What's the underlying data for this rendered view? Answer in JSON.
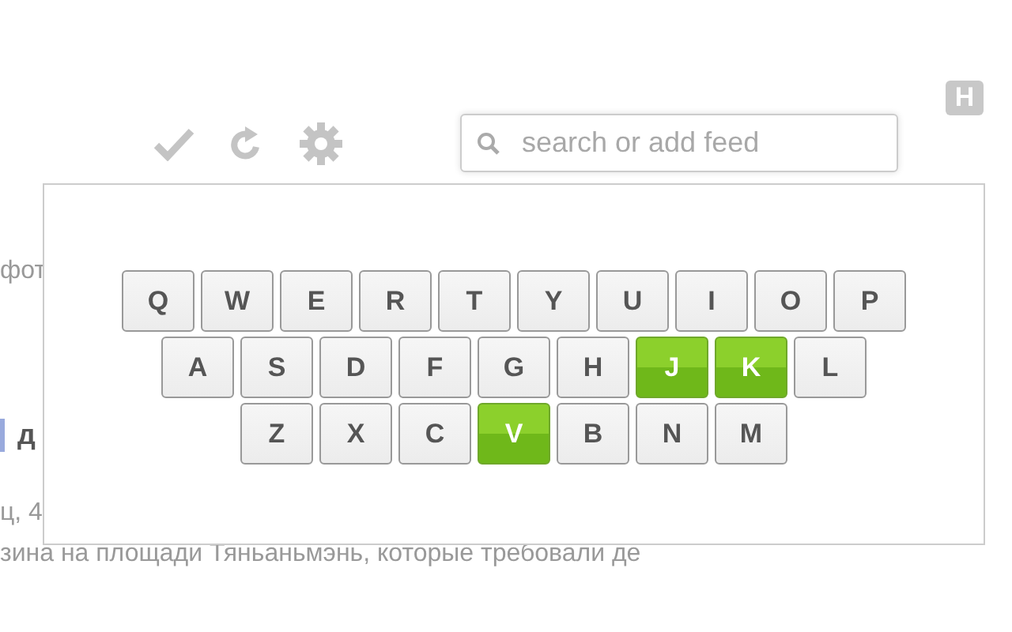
{
  "toolbar": {
    "search": {
      "placeholder": "search or add feed"
    },
    "badge": "H"
  },
  "background_text": [
    {
      "text": "фот",
      "bold": false
    },
    {
      "text": "д",
      "bold": true
    },
    {
      "text": "ц, 4",
      "bold": false
    },
    {
      "text": "зина на площади Тяньаньмэнь, которые требовали де",
      "bold": false
    }
  ],
  "keyboard": {
    "rows": [
      [
        {
          "label": "Q",
          "selected": false
        },
        {
          "label": "W",
          "selected": false
        },
        {
          "label": "E",
          "selected": false
        },
        {
          "label": "R",
          "selected": false
        },
        {
          "label": "T",
          "selected": false
        },
        {
          "label": "Y",
          "selected": false
        },
        {
          "label": "U",
          "selected": false
        },
        {
          "label": "I",
          "selected": false
        },
        {
          "label": "O",
          "selected": false
        },
        {
          "label": "P",
          "selected": false
        }
      ],
      [
        {
          "label": "A",
          "selected": false
        },
        {
          "label": "S",
          "selected": false
        },
        {
          "label": "D",
          "selected": false
        },
        {
          "label": "F",
          "selected": false
        },
        {
          "label": "G",
          "selected": false
        },
        {
          "label": "H",
          "selected": false
        },
        {
          "label": "J",
          "selected": true
        },
        {
          "label": "K",
          "selected": true
        },
        {
          "label": "L",
          "selected": false
        }
      ],
      [
        {
          "label": "Z",
          "selected": false
        },
        {
          "label": "X",
          "selected": false
        },
        {
          "label": "C",
          "selected": false
        },
        {
          "label": "V",
          "selected": true
        },
        {
          "label": "B",
          "selected": false
        },
        {
          "label": "N",
          "selected": false
        },
        {
          "label": "M",
          "selected": false
        }
      ]
    ]
  }
}
